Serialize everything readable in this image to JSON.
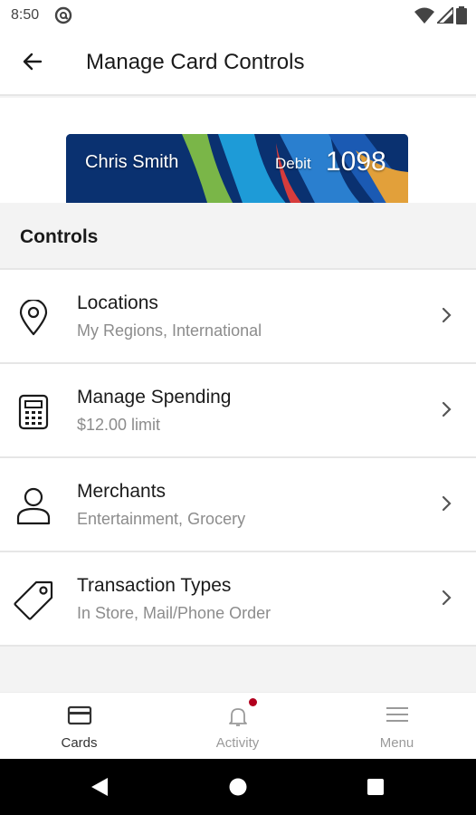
{
  "status_bar": {
    "time": "8:50"
  },
  "app_bar": {
    "title": "Manage Card Controls"
  },
  "card": {
    "holder_name": "Chris Smith",
    "type": "Debit",
    "last4": "1098"
  },
  "section": {
    "title": "Controls"
  },
  "controls": [
    {
      "title": "Locations",
      "subtitle": "My Regions, International",
      "icon": "location-pin-icon"
    },
    {
      "title": "Manage Spending",
      "subtitle": "$12.00 limit",
      "icon": "calculator-icon"
    },
    {
      "title": "Merchants",
      "subtitle": "Entertainment, Grocery",
      "icon": "person-icon"
    },
    {
      "title": "Transaction Types",
      "subtitle": "In Store, Mail/Phone Order",
      "icon": "tag-icon"
    }
  ],
  "bottom_nav": [
    {
      "label": "Cards",
      "icon": "card-icon",
      "active": true
    },
    {
      "label": "Activity",
      "icon": "bell-icon",
      "active": false,
      "has_notification": true
    },
    {
      "label": "Menu",
      "icon": "hamburger-icon",
      "active": false
    }
  ],
  "colors": {
    "accent": "#b2001e",
    "card_background": "#0a3170",
    "active_nav": "#333333",
    "inactive_nav": "#9a9a9a",
    "subtitle": "#8c8c8c"
  }
}
